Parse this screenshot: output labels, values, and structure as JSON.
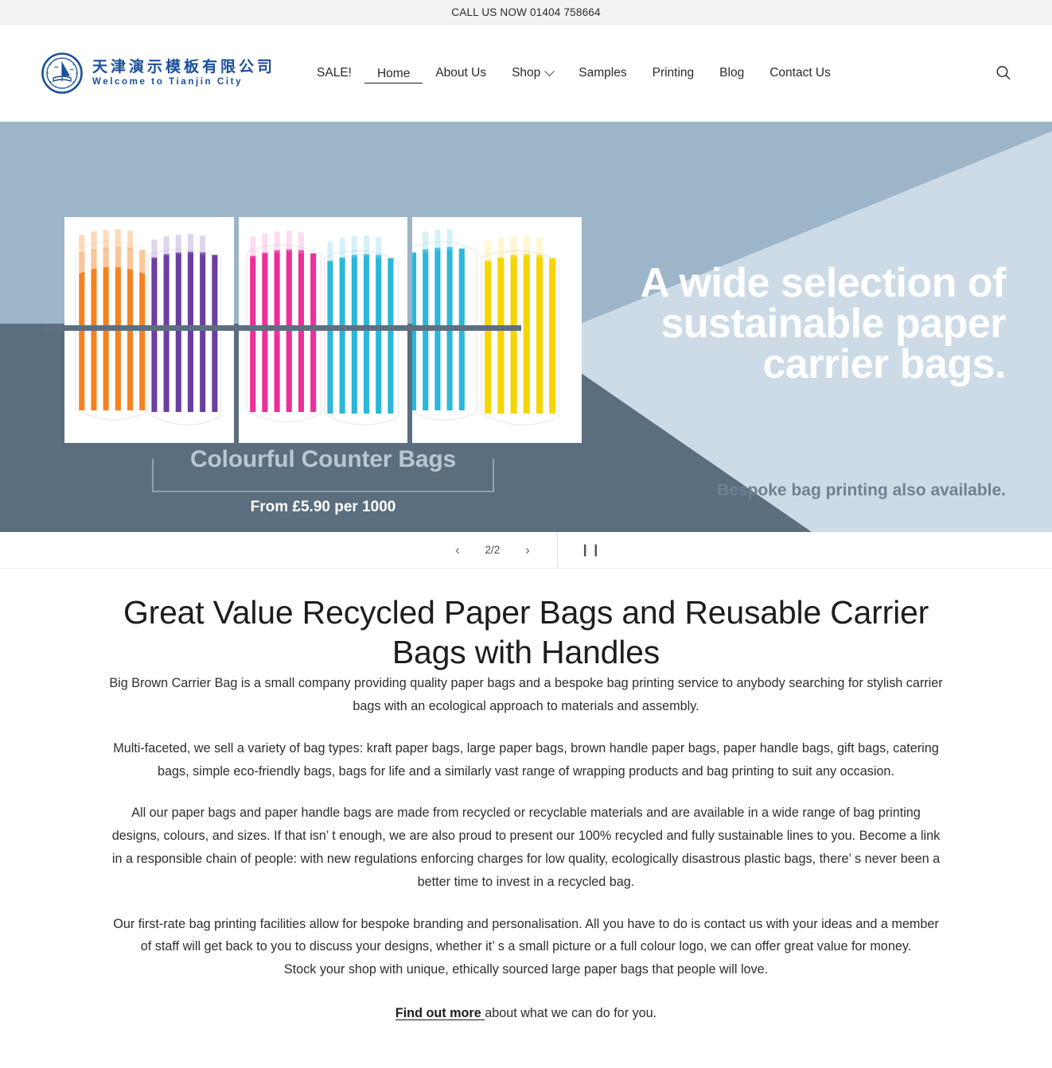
{
  "topbar": {
    "text": "CALL US NOW 01404 758664"
  },
  "header": {
    "brand": {
      "name_cn": "天津演示模板有限公司",
      "name_en": "Welcome to Tianjin City",
      "emblem_color": "#1a4f9c"
    },
    "nav": [
      {
        "label": "SALE!",
        "active": false,
        "has_dropdown": false
      },
      {
        "label": "Home",
        "active": true,
        "has_dropdown": false
      },
      {
        "label": "About Us",
        "active": false,
        "has_dropdown": false
      },
      {
        "label": "Shop",
        "active": false,
        "has_dropdown": true
      },
      {
        "label": "Samples",
        "active": false,
        "has_dropdown": false
      },
      {
        "label": "Printing",
        "active": false,
        "has_dropdown": false
      },
      {
        "label": "Blog",
        "active": false,
        "has_dropdown": false
      },
      {
        "label": "Contact Us",
        "active": false,
        "has_dropdown": false
      }
    ],
    "search_icon": "search-icon"
  },
  "hero": {
    "headline": "A wide selection of sustainable paper carrier bags.",
    "subline": "Bespoke bag printing also available.",
    "caption_title": "Colourful Counter Bags",
    "caption_price": "From £5.90 per 1000",
    "colors": {
      "sky_light": "#ccdbe6",
      "sky_mid": "#9db5c8",
      "slate_dark": "#5b6e7e",
      "caption_text": "#b8c7d4"
    },
    "bag_colors": [
      "#f58220",
      "#6b3fa0",
      "#ec2f9b",
      "#2bb7da",
      "#f6d500"
    ]
  },
  "slider": {
    "prev_label": "‹",
    "next_label": "›",
    "counter": "2/2",
    "pause_label": "❙❙"
  },
  "main": {
    "title": "Great Value Recycled Paper Bags and Reusable Carrier Bags with Handles",
    "paragraphs": [
      "Big Brown Carrier Bag is a small company providing quality paper bags and a bespoke bag printing service to anybody searching for stylish carrier bags with an ecological approach to materials and assembly.",
      "Multi-faceted, we sell a variety of bag types: kraft paper bags, large paper bags, brown handle paper bags, paper handle bags, gift bags, catering bags, simple eco-friendly bags, bags for life and a similarly vast range of wrapping products and bag printing to suit any occasion.",
      "All our paper bags and paper handle bags are made from recycled or recyclable materials and are available in a wide range of bag printing designs, colours, and sizes. If that isn’ t enough, we are also proud to present our 100% recycled and fully sustainable lines to you. Become a link in a responsible chain of people: with new regulations enforcing charges for low quality, ecologically disastrous plastic bags, there’ s never been a better time to invest in a recycled bag.",
      "Our first-rate bag printing facilities allow for bespoke branding and personalisation. All you have to do is contact us with your ideas and a member of staff will get back to you to discuss your designs, whether it’ s a small picture or a full colour logo, we can offer great value for money.",
      "Stock your shop with unique, ethically sourced large paper bags that people will love."
    ],
    "cta_link": "Find out more ",
    "cta_rest": "about what we can do for you."
  }
}
